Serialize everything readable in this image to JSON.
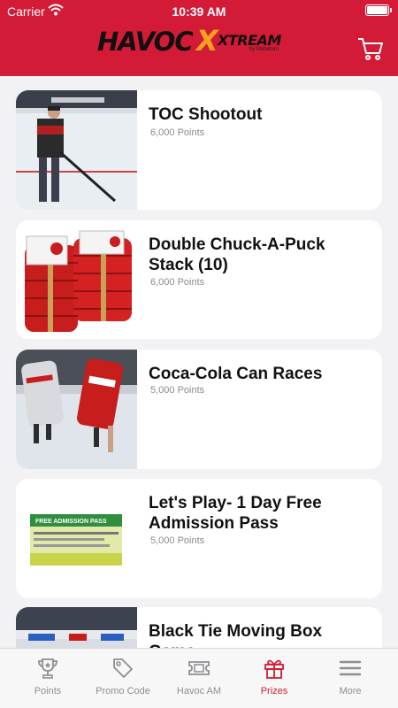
{
  "status_bar": {
    "carrier": "Carrier",
    "time": "10:39 AM"
  },
  "header": {
    "logo": {
      "brand": "HAVOC",
      "x_mark": "X",
      "sub": "XTREAM",
      "by_line": "by Mobetom"
    },
    "cart_icon": "cart-icon"
  },
  "prizes": [
    {
      "title": "TOC Shootout",
      "points": "6,000 Points"
    },
    {
      "title": "Double Chuck-A-Puck Stack (10)",
      "points": "6,000 Points"
    },
    {
      "title": "Coca-Cola Can Races",
      "points": "5,000 Points"
    },
    {
      "title": "Let's Play- 1 Day Free Admission Pass",
      "points": "5,000 Points",
      "thumb_text": "FREE ADMISSION PASS"
    },
    {
      "title": "Black Tie Moving Box Game",
      "points": ""
    }
  ],
  "tabs": [
    {
      "label": "Points",
      "icon": "trophy-icon"
    },
    {
      "label": "Promo Code",
      "icon": "tag-icon"
    },
    {
      "label": "Havoc AM",
      "icon": "ticket-icon"
    },
    {
      "label": "Prizes",
      "icon": "gift-icon",
      "active": true
    },
    {
      "label": "More",
      "icon": "menu-icon"
    }
  ],
  "colors": {
    "brand_red": "#d31a36",
    "accent_orange": "#f6a21c",
    "inactive_gray": "#8e8e93"
  }
}
